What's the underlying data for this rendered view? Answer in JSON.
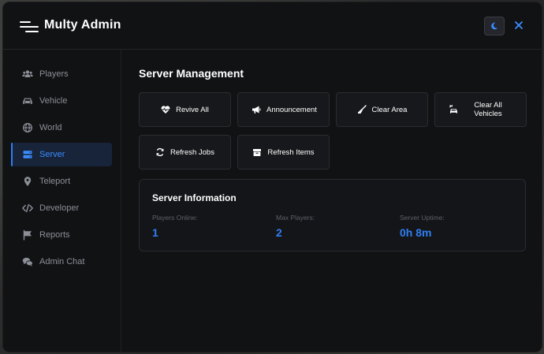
{
  "app": {
    "title": "Multy Admin"
  },
  "sidebar": {
    "items": [
      {
        "label": "Players",
        "icon": "users-icon",
        "active": false
      },
      {
        "label": "Vehicle",
        "icon": "car-icon",
        "active": false
      },
      {
        "label": "World",
        "icon": "globe-icon",
        "active": false
      },
      {
        "label": "Server",
        "icon": "server-icon",
        "active": true
      },
      {
        "label": "Teleport",
        "icon": "map-pin-icon",
        "active": false
      },
      {
        "label": "Developer",
        "icon": "code-icon",
        "active": false
      },
      {
        "label": "Reports",
        "icon": "flag-icon",
        "active": false
      },
      {
        "label": "Admin Chat",
        "icon": "comments-icon",
        "active": false
      }
    ]
  },
  "main": {
    "title": "Server Management",
    "actions": [
      {
        "label": "Revive All",
        "icon": "heart-pulse-icon"
      },
      {
        "label": "Announcement",
        "icon": "megaphone-icon"
      },
      {
        "label": "Clear Area",
        "icon": "broom-icon"
      },
      {
        "label": "Clear All Vehicles",
        "icon": "car-burst-icon"
      },
      {
        "label": "Refresh Jobs",
        "icon": "refresh-icon"
      },
      {
        "label": "Refresh Items",
        "icon": "box-icon"
      }
    ],
    "info": {
      "title": "Server Information",
      "stats": [
        {
          "label": "Players Online:",
          "value": "1"
        },
        {
          "label": "Max Players:",
          "value": "2"
        },
        {
          "label": "Server Uptime:",
          "value": "0h 8m"
        }
      ]
    }
  },
  "colors": {
    "accent": "#2f7ef2",
    "background": "#111214",
    "active_bg": "#172439"
  }
}
